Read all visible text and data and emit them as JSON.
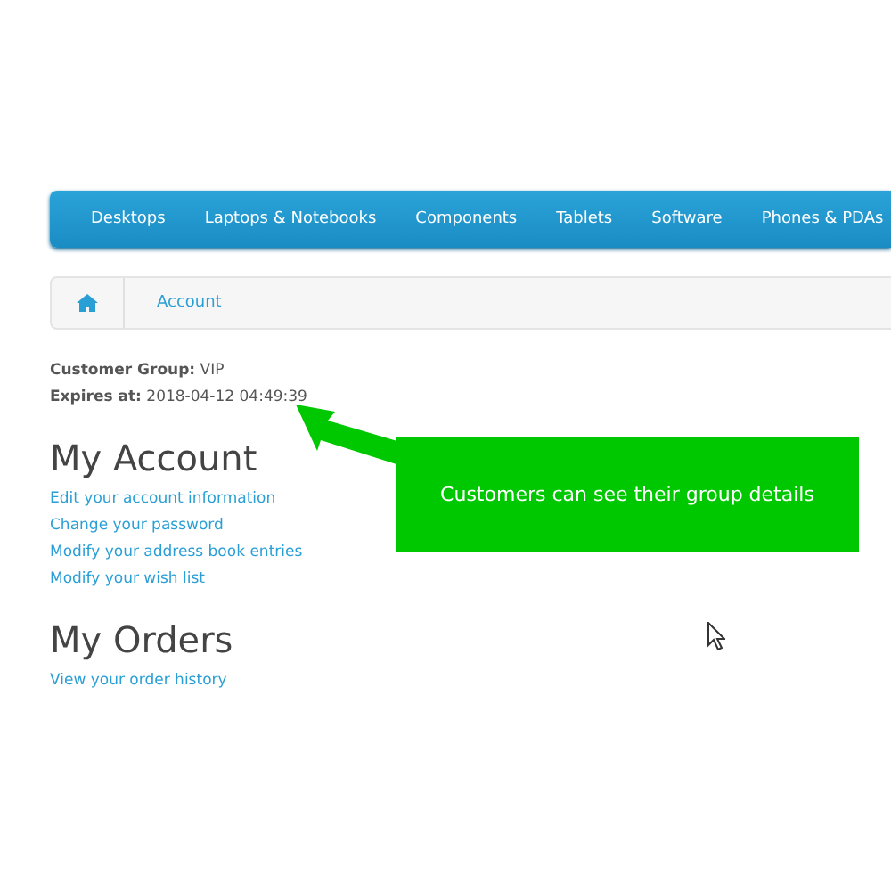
{
  "nav": {
    "items": [
      "Desktops",
      "Laptops & Notebooks",
      "Components",
      "Tablets",
      "Software",
      "Phones & PDAs"
    ]
  },
  "breadcrumb": {
    "items": [
      "Account"
    ]
  },
  "customer": [
    {
      "label": "Customer Group:",
      "value": "VIP"
    },
    {
      "label": "Expires at:",
      "value": "2018-04-12 04:49:39"
    }
  ],
  "sections": [
    {
      "title": "My Account",
      "links": [
        "Edit your account information",
        "Change your password",
        "Modify your address book entries",
        "Modify your wish list"
      ]
    },
    {
      "title": "My Orders",
      "links": [
        "View your order history"
      ]
    }
  ],
  "callout": {
    "text": "Customers can see their group details"
  }
}
